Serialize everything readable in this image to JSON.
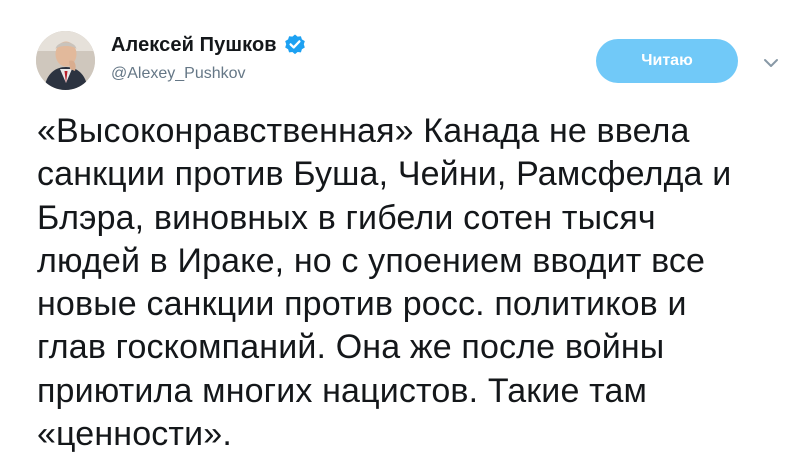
{
  "author": {
    "display_name": "Алексей Пушков",
    "handle": "@Alexey_Pushkov",
    "verified": true,
    "avatar": "profile-photo"
  },
  "actions": {
    "follow_label": "Читаю",
    "menu_icon": "chevron-down-icon"
  },
  "tweet": {
    "text": "«Высоконравственная» Канада не ввела\nсанкции против Буша, Чейни, Рамсфелда и\nБлэра, виновных в гибели сотен тысяч\nлюдей в Ираке, но с упоением вводит все\nновые санкции против росс. политиков и\nглав госкомпаний. Она же после войны\nприютила многих нацистов. Такие там\n«ценности»."
  },
  "colors": {
    "follow_button": "#71c9f8",
    "verified_badge": "#1da1f2",
    "handle_text": "#657786",
    "body_text": "#14171a"
  }
}
